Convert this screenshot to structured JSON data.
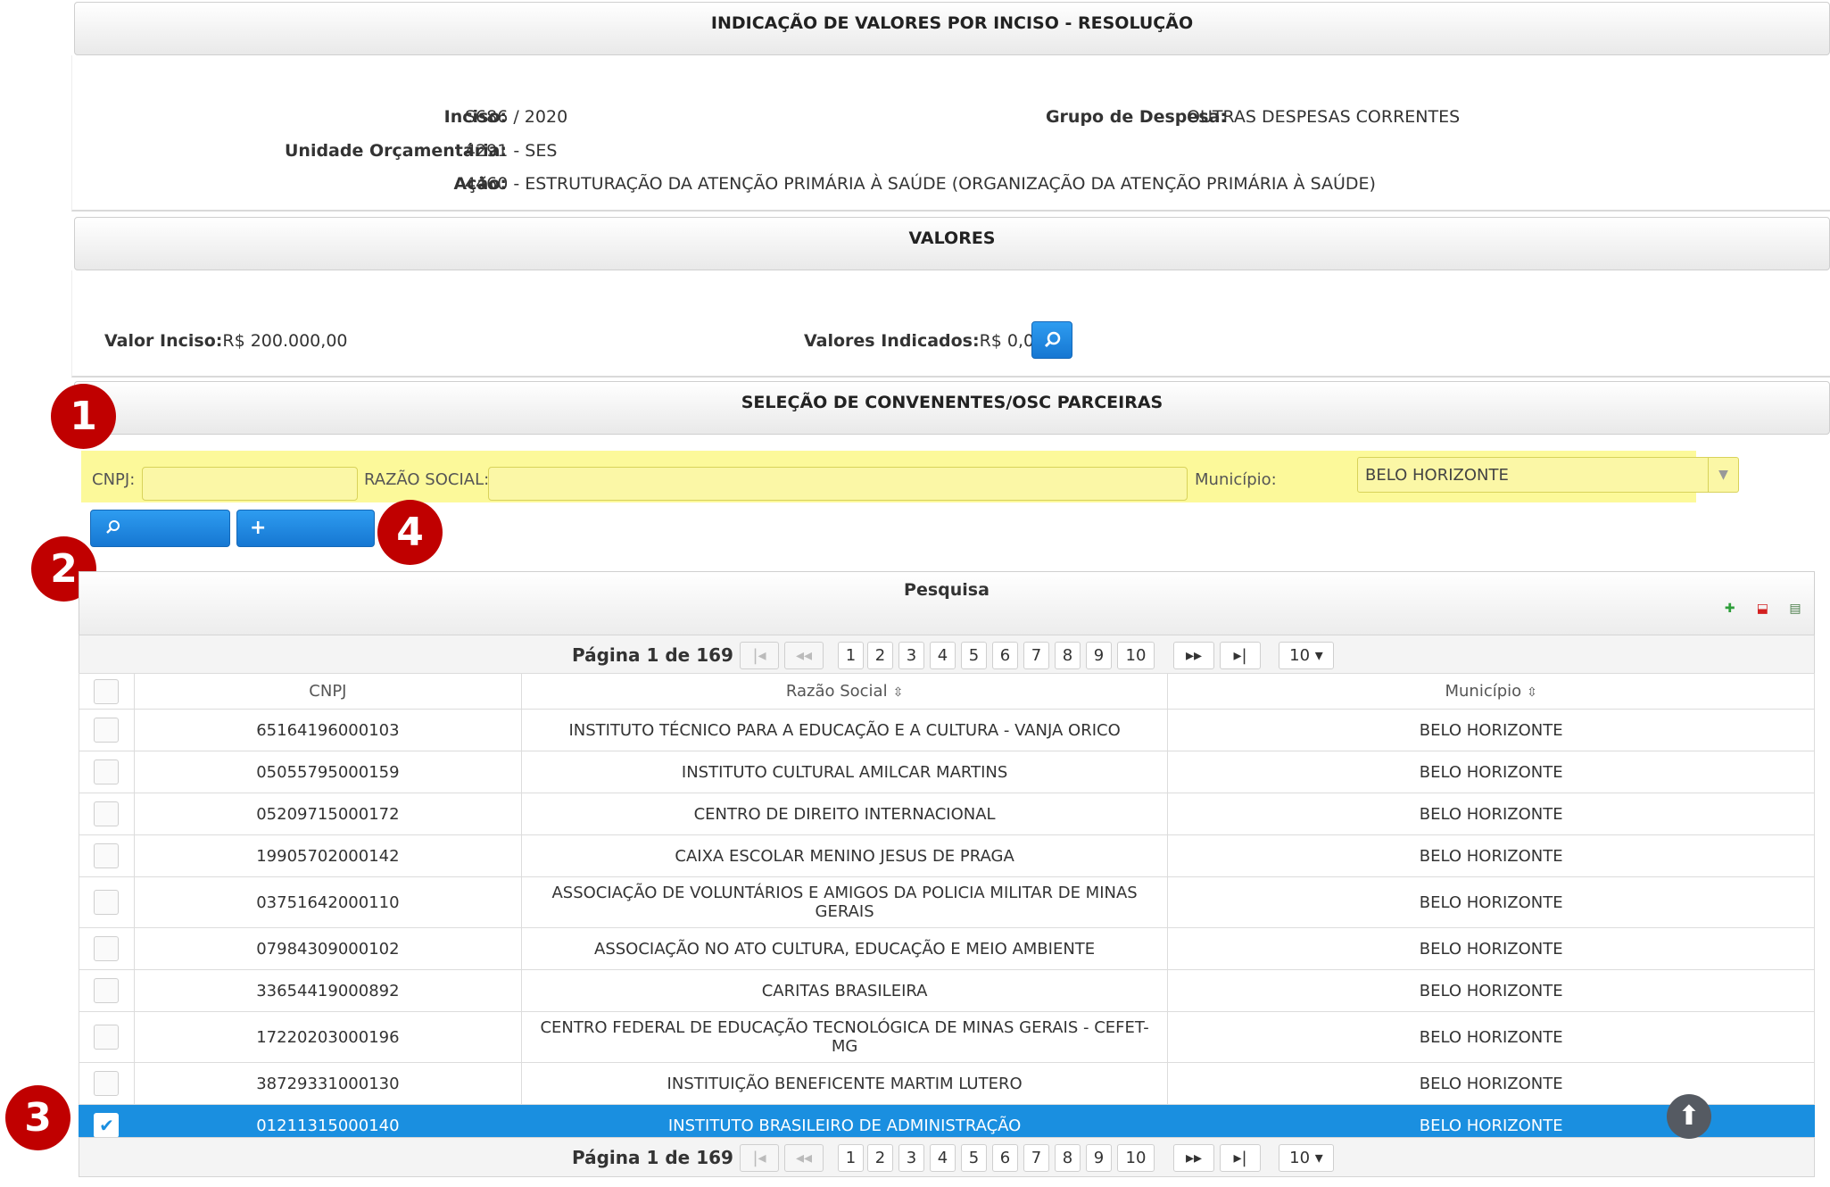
{
  "header1": {
    "title": "INDICAÇÃO DE VALORES POR INCISO - RESOLUÇÃO"
  },
  "info": {
    "inciso_label": "Inciso:",
    "inciso_value": "S686 / 2020",
    "grupo_label": "Grupo de Despesa:",
    "grupo_value": "OUTRAS DESPESAS CORRENTES",
    "unidade_label": "Unidade Orçamentária:",
    "unidade_value": "4291 - SES",
    "acao_label": "Ação:",
    "acao_value": "4460 - ESTRUTURAÇÃO DA ATENÇÃO PRIMÁRIA À SAÚDE (ORGANIZAÇÃO DA ATENÇÃO PRIMÁRIA À SAÚDE)"
  },
  "header2": {
    "title": "VALORES"
  },
  "valores": {
    "valor_inciso_label": "Valor Inciso:",
    "valor_inciso_value": "R$ 200.000,00",
    "indicados_label": "Valores Indicados:",
    "indicados_value": "R$ 0,00"
  },
  "header3": {
    "title": "SELEÇÃO DE CONVENENTES/OSC PARCEIRAS"
  },
  "filters": {
    "cnpj_label": "CNPJ:",
    "cnpj_value": "",
    "razao_label": "RAZÃO SOCIAL:",
    "razao_value": "",
    "municipio_label": "Município:",
    "municipio_value": "BELO HORIZONTE"
  },
  "buttons": {
    "pesquisar": "Pesquisar",
    "adicionar": "Adicionar"
  },
  "badges": {
    "b1": "1",
    "b2": "2",
    "b3": "3",
    "b4": "4"
  },
  "grid": {
    "title": "Pesquisa",
    "page_text": "Página 1 de 169",
    "pages": [
      "1",
      "2",
      "3",
      "4",
      "5",
      "6",
      "7",
      "8",
      "9",
      "10"
    ],
    "per_page": "10 ▾",
    "columns": {
      "cnpj": "CNPJ",
      "razao": "Razão Social",
      "municipio": "Município"
    },
    "rows": [
      {
        "cnpj": "65164196000103",
        "razao": "INSTITUTO TÉCNICO PARA A EDUCAÇÃO E A CULTURA - VANJA ORICO",
        "municipio": "BELO HORIZONTE"
      },
      {
        "cnpj": "05055795000159",
        "razao": "INSTITUTO CULTURAL AMILCAR MARTINS",
        "municipio": "BELO HORIZONTE"
      },
      {
        "cnpj": "05209715000172",
        "razao": "CENTRO DE DIREITO INTERNACIONAL",
        "municipio": "BELO HORIZONTE"
      },
      {
        "cnpj": "19905702000142",
        "razao": "CAIXA ESCOLAR MENINO JESUS DE PRAGA",
        "municipio": "BELO HORIZONTE"
      },
      {
        "cnpj": "03751642000110",
        "razao": "ASSOCIAÇÃO DE VOLUNTÁRIOS E AMIGOS DA POLICIA MILITAR DE MINAS GERAIS",
        "municipio": "BELO HORIZONTE"
      },
      {
        "cnpj": "07984309000102",
        "razao": "ASSOCIAÇÃO NO ATO CULTURA, EDUCAÇÃO E MEIO AMBIENTE",
        "municipio": "BELO HORIZONTE"
      },
      {
        "cnpj": "33654419000892",
        "razao": "CARITAS BRASILEIRA",
        "municipio": "BELO HORIZONTE"
      },
      {
        "cnpj": "17220203000196",
        "razao": "CENTRO FEDERAL DE EDUCAÇÃO TECNOLÓGICA DE MINAS GERAIS - CEFET-MG",
        "municipio": "BELO HORIZONTE"
      },
      {
        "cnpj": "38729331000130",
        "razao": "INSTITUIÇÃO BENEFICENTE MARTIM LUTERO",
        "municipio": "BELO HORIZONTE"
      },
      {
        "cnpj": "01211315000140",
        "razao": "INSTITUTO BRASILEIRO DE ADMINISTRAÇÃO",
        "municipio": "BELO HORIZONTE",
        "selected": true
      }
    ]
  },
  "colors": {
    "accent": "#1a8fe0",
    "badge": "#c00000",
    "highlight": "#fcf99a"
  },
  "icons": [
    "search-icon",
    "plus-icon",
    "excel-icon",
    "pdf-icon",
    "csv-icon",
    "arrow-up-icon",
    "checkmark-icon",
    "sort-icon"
  ]
}
